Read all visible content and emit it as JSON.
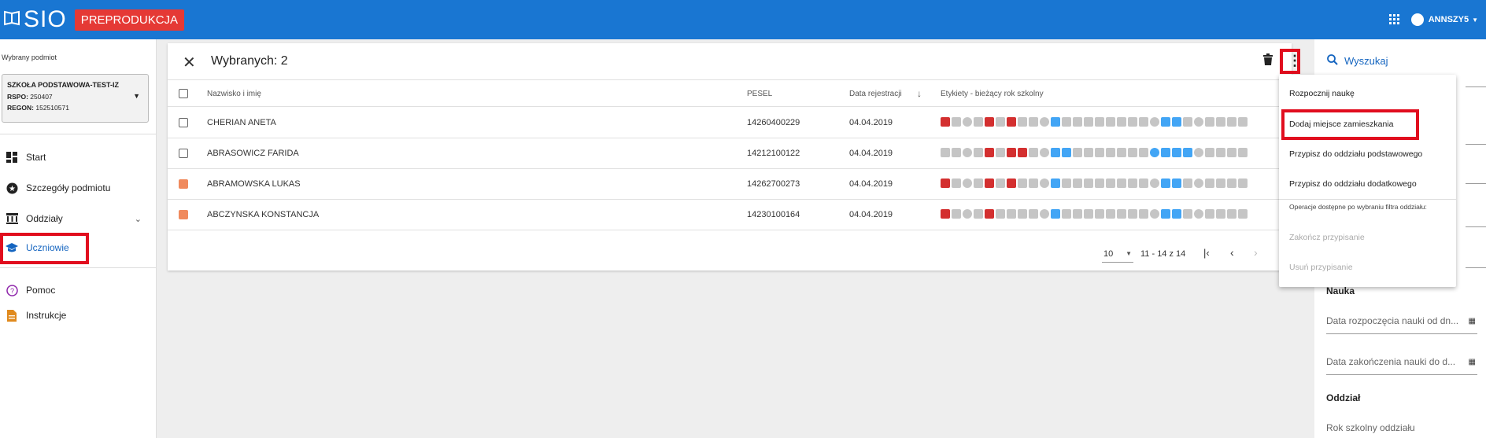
{
  "header": {
    "app_name": "SIO",
    "env_badge": "PREPRODUKCJA",
    "user_name": "ANNSZY5"
  },
  "sidebar": {
    "selected_subject_label": "Wybrany podmiot",
    "school_name": "SZKOŁA PODSTAWOWA-TEST-IZ",
    "rspo_label": "RSPO:",
    "rspo_value": "250407",
    "regon_label": "REGON:",
    "regon_value": "152510571",
    "items": [
      {
        "label": "Start",
        "icon": "dashboard-icon"
      },
      {
        "label": "Szczegóły podmiotu",
        "icon": "star-icon"
      },
      {
        "label": "Oddziały",
        "icon": "building-icon"
      },
      {
        "label": "Uczniowie",
        "icon": "graduation-cap-icon"
      },
      {
        "label": "Pomoc",
        "icon": "help-icon"
      },
      {
        "label": "Instrukcje",
        "icon": "document-icon"
      }
    ]
  },
  "selection": {
    "title": "Wybranych: 2"
  },
  "table": {
    "headers": [
      "Nazwisko i imię",
      "PESEL",
      "Data rejestracji",
      "Etykiety - bieżący rok szkolny"
    ],
    "rows": [
      {
        "name": "CHERIAN ANETA",
        "pesel": "14260400229",
        "date": "04.04.2019",
        "checked": false
      },
      {
        "name": "ABRASOWICZ FARIDA",
        "pesel": "14212100122",
        "date": "04.04.2019",
        "checked": false
      },
      {
        "name": "ABRAMOWSKA LUKAS",
        "pesel": "14262700273",
        "date": "04.04.2019",
        "checked": true
      },
      {
        "name": "ABCZYNSKA KONSTANCJA",
        "pesel": "14230100164",
        "date": "04.04.2019",
        "checked": true
      }
    ]
  },
  "pager": {
    "page_size": "10",
    "range": "11 - 14 z 14"
  },
  "menu": {
    "items": [
      {
        "label": "Rozpocznij naukę",
        "disabled": false
      },
      {
        "label": "Dodaj miejsce zamieszkania",
        "disabled": false
      },
      {
        "label": "Przypisz do oddziału podstawowego",
        "disabled": false
      },
      {
        "label": "Przypisz do oddziału dodatkowego",
        "disabled": false
      }
    ],
    "note": "Operacje dostępne po wybraniu filtra oddziału:",
    "disabled_items": [
      {
        "label": "Zakończ przypisanie"
      },
      {
        "label": "Usuń przypisanie"
      }
    ]
  },
  "filters": {
    "search_label": "Wyszukaj",
    "section_nauka": "Nauka",
    "field_start": "Data rozpoczęcia nauki od dn...",
    "field_end": "Data zakończenia nauki do d...",
    "section_oddzial": "Oddział",
    "field_year": "Rok szkolny oddziału"
  },
  "colors": {
    "topbar": "#1976d2",
    "badge": "#e53935",
    "highlight": "#e10d1e",
    "checkbox": "#f08a5d"
  }
}
